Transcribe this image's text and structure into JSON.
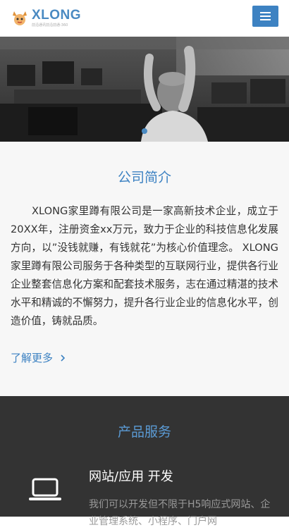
{
  "header": {
    "logo_title": "XLONG",
    "logo_subtitle": "前沿通讯前沿前通-360",
    "menu_icon": "hamburger-menu-icon",
    "accent_color": "#3d82c2"
  },
  "about": {
    "title": "公司简介",
    "body": "XLONG家里蹲有限公司是一家高新技术企业，成立于20XX年，注册资金xx万元，致力于企业的科技信息化发展方向，以”没钱就赚，有钱就花”为核心价值理念。 XLONG家里蹲有限公司服务于各种类型的互联网行业，提供各行业企业整套信息化方案和配套技术服务，志在通过精湛的技术水平和精诚的不懈努力，提升各行业企业的信息化水平，创造价值，铸就品质。",
    "more_label": "了解更多",
    "more_icon": "chevron-right-icon"
  },
  "products": {
    "title": "产品服务",
    "service_title": "网站/应用 开发",
    "service_desc": "我们可以开发但不限于H5响应式网站、企业管理系统、小程序、门户网",
    "service_icon": "laptop-icon"
  }
}
